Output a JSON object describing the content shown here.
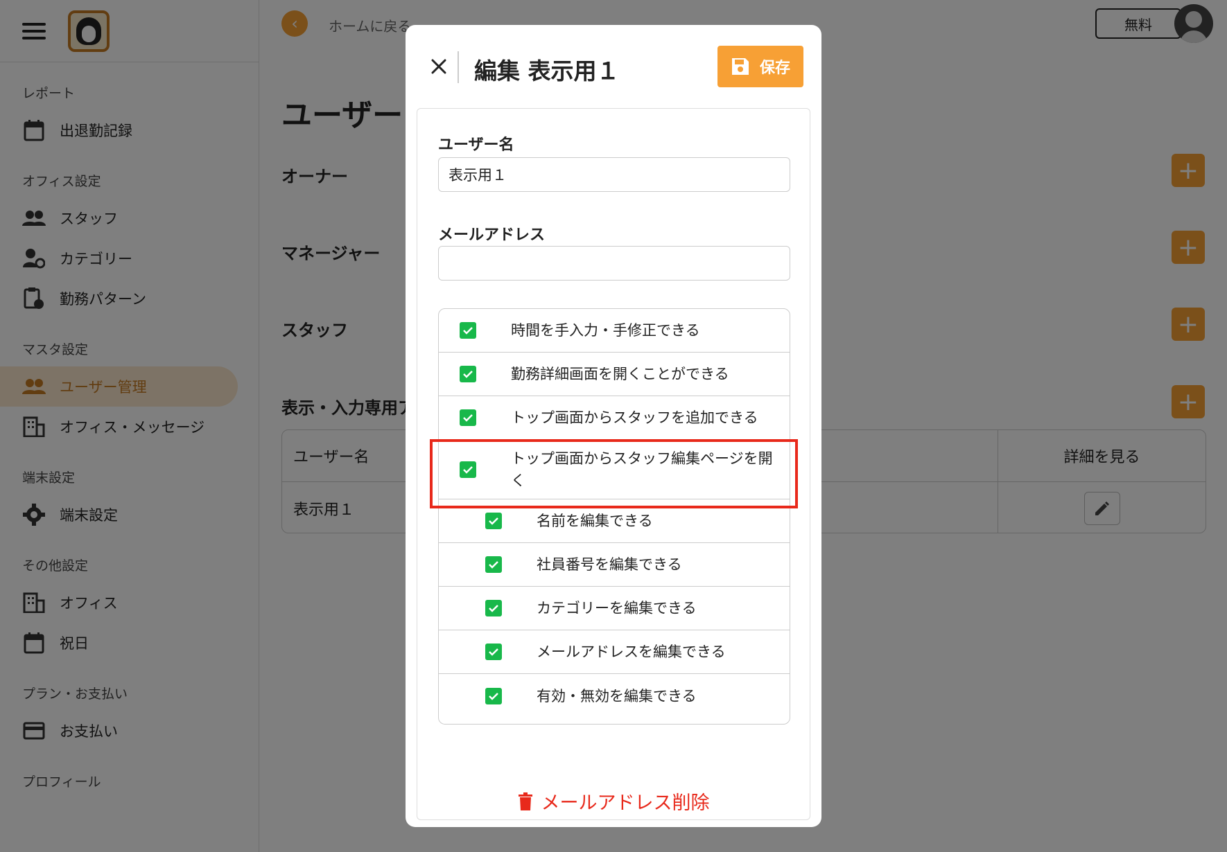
{
  "sidebar": {
    "sections": [
      {
        "title": "レポート",
        "items": [
          {
            "label": "出退勤記録",
            "icon": "calendar-icon"
          }
        ]
      },
      {
        "title": "オフィス設定",
        "items": [
          {
            "label": "スタッフ",
            "icon": "people-icon"
          },
          {
            "label": "カテゴリー",
            "icon": "person-gear-icon"
          },
          {
            "label": "勤務パターン",
            "icon": "clipboard-clock-icon"
          }
        ]
      },
      {
        "title": "マスタ設定",
        "items": [
          {
            "label": "ユーザー管理",
            "icon": "people-icon",
            "active": true
          },
          {
            "label": "オフィス・メッセージ",
            "icon": "building-icon"
          }
        ]
      },
      {
        "title": "端末設定",
        "items": [
          {
            "label": "端末設定",
            "icon": "gear-icon"
          }
        ]
      },
      {
        "title": "その他設定",
        "items": [
          {
            "label": "オフィス",
            "icon": "building-icon"
          },
          {
            "label": "祝日",
            "icon": "calendar-icon"
          }
        ]
      },
      {
        "title": "プラン・お支払い",
        "items": [
          {
            "label": "お支払い",
            "icon": "credit-card-icon"
          }
        ]
      },
      {
        "title": "プロフィール",
        "items": []
      }
    ]
  },
  "header": {
    "back_label": "ホームに戻る",
    "plan_badge": "無料"
  },
  "main": {
    "title": "ユーザー",
    "sections": [
      "オーナー",
      "マネージャー",
      "スタッフ",
      "表示・入力専用ア"
    ],
    "table": {
      "headers": [
        "ユーザー名",
        "詳細を見る"
      ],
      "rows": [
        {
          "name": "表示用１"
        }
      ]
    }
  },
  "modal": {
    "title": "編集 表示用１",
    "save_label": "保存",
    "username_label": "ユーザー名",
    "username_value": "表示用１",
    "email_label": "メールアドレス",
    "email_value": "",
    "permissions": [
      {
        "label": "時間を手入力・手修正できる",
        "checked": true,
        "level": 0
      },
      {
        "label": "勤務詳細画面を開くことができる",
        "checked": true,
        "level": 0
      },
      {
        "label": "トップ画面からスタッフを追加できる",
        "checked": true,
        "level": 0
      },
      {
        "label": "トップ画面からスタッフ編集ページを開く",
        "checked": true,
        "level": 0
      },
      {
        "label": "名前を編集できる",
        "checked": true,
        "level": 1
      },
      {
        "label": "社員番号を編集できる",
        "checked": true,
        "level": 1
      },
      {
        "label": "カテゴリーを編集できる",
        "checked": true,
        "level": 1
      },
      {
        "label": "メールアドレスを編集できる",
        "checked": true,
        "level": 1
      },
      {
        "label": "有効・無効を編集できる",
        "checked": true,
        "level": 1
      }
    ],
    "delete_label": "メールアドレス削除"
  },
  "colors": {
    "accent": "#f7a035",
    "checkbox": "#18b84a",
    "danger": "#e8291b",
    "highlight": "#e8291b"
  }
}
